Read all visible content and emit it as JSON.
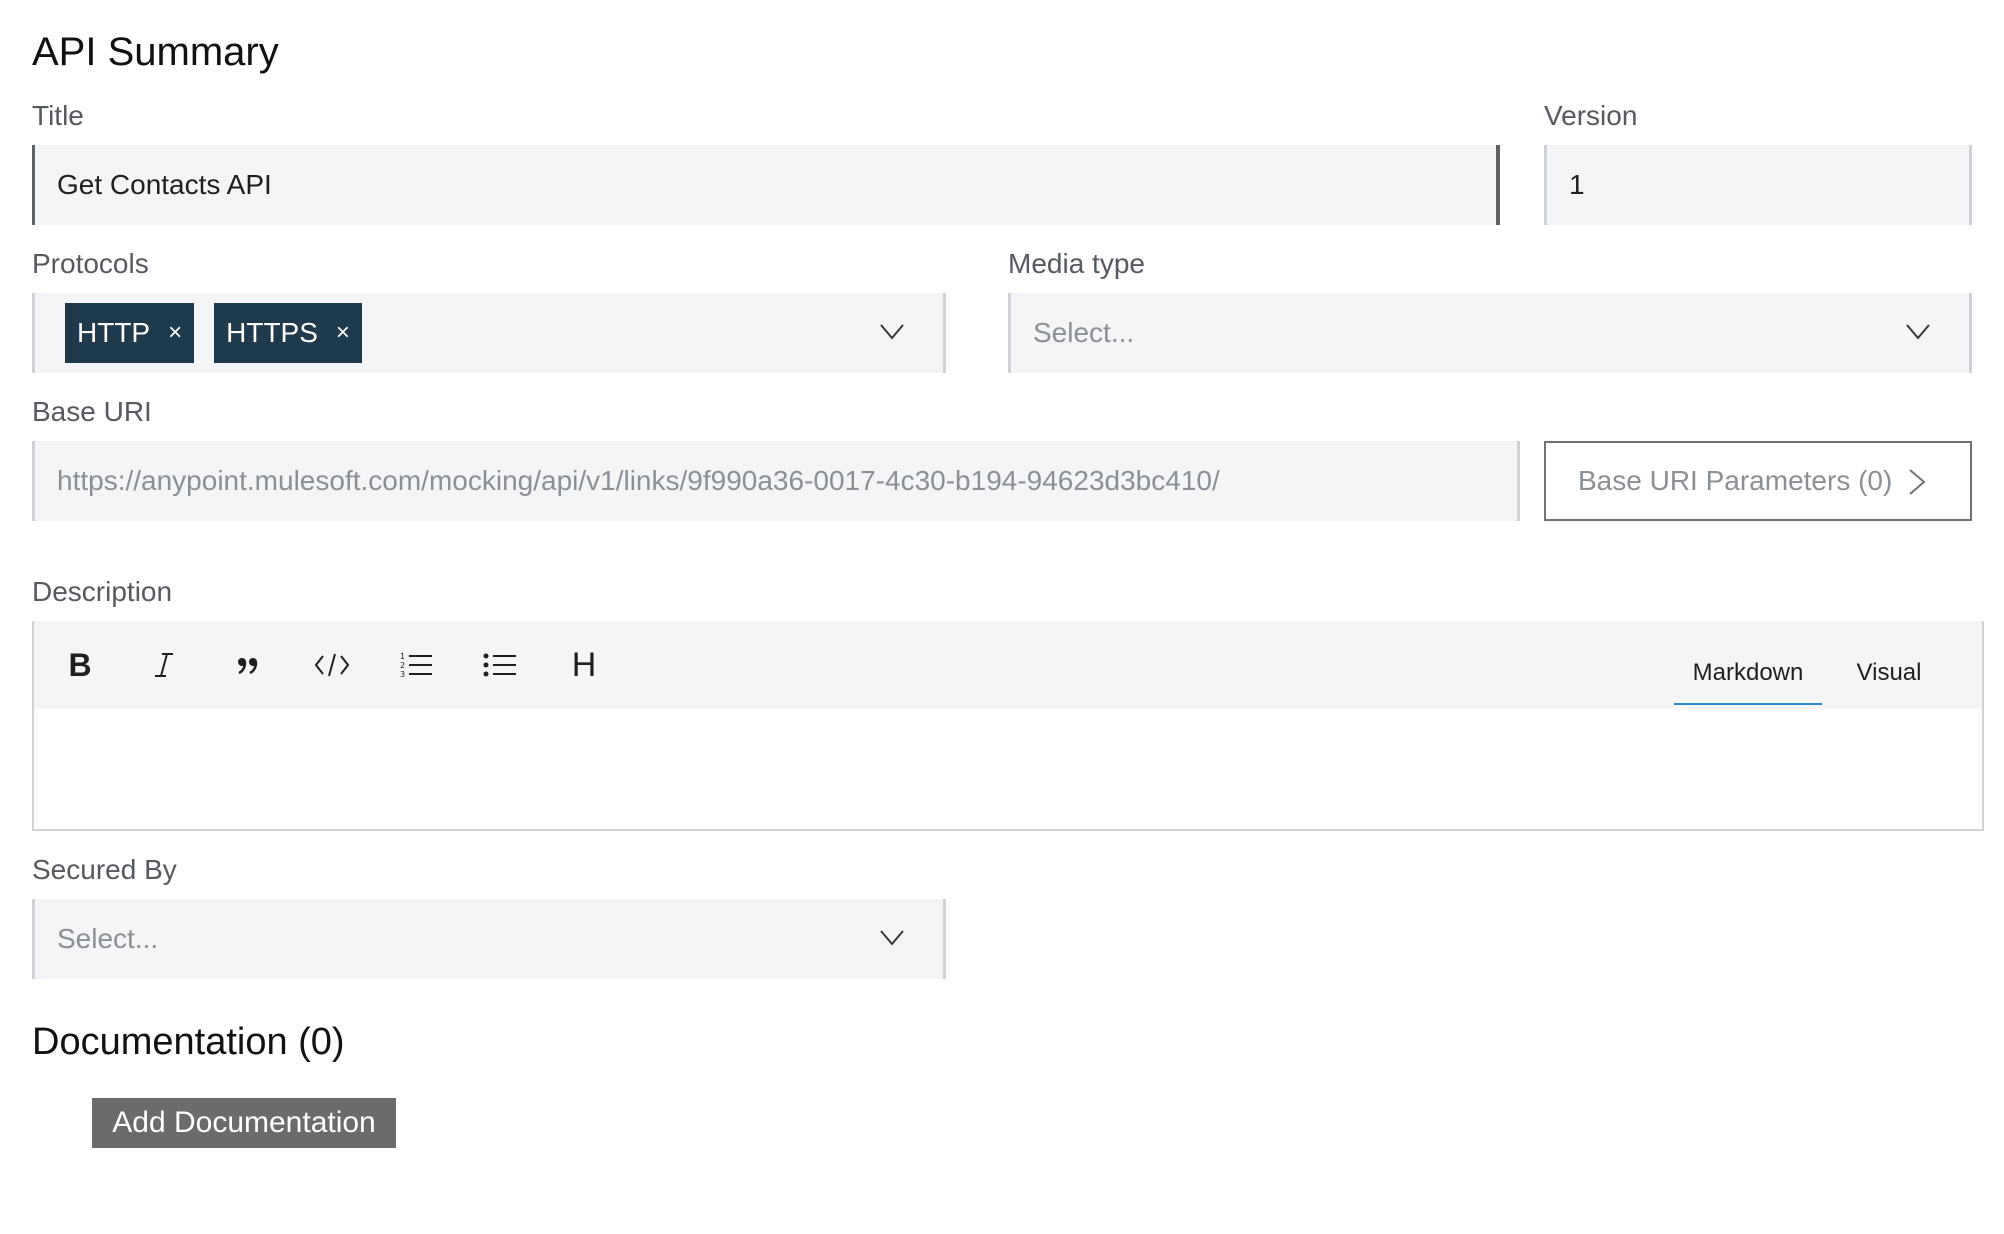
{
  "summary": {
    "heading": "API Summary"
  },
  "title_field": {
    "label": "Title",
    "value": "Get Contacts API"
  },
  "version_field": {
    "label": "Version",
    "value": "1"
  },
  "protocols": {
    "label": "Protocols",
    "chips": [
      {
        "label": "HTTP",
        "remove": "×"
      },
      {
        "label": "HTTPS",
        "remove": "×"
      }
    ]
  },
  "media_type": {
    "label": "Media type",
    "placeholder": "Select..."
  },
  "base_uri": {
    "label": "Base URI",
    "value": "https://anypoint.mulesoft.com/mocking/api/v1/links/9f990a36-0017-4c30-b194-94623d3bc410/",
    "params_button": "Base URI Parameters (0)"
  },
  "description": {
    "label": "Description",
    "tools": {
      "bold": "B",
      "heading": "H"
    },
    "modes": {
      "markdown": "Markdown",
      "visual": "Visual",
      "selected": "Markdown"
    }
  },
  "secured_by": {
    "label": "Secured By",
    "placeholder": "Select..."
  },
  "documentation": {
    "heading": "Documentation (0)",
    "add_button": "Add Documentation"
  },
  "colors": {
    "chip_bg": "#1f3a4d",
    "tab_underline": "#2a8ad6",
    "field_bg": "#f4f5f6",
    "dark_button": "#6b6b6b"
  }
}
